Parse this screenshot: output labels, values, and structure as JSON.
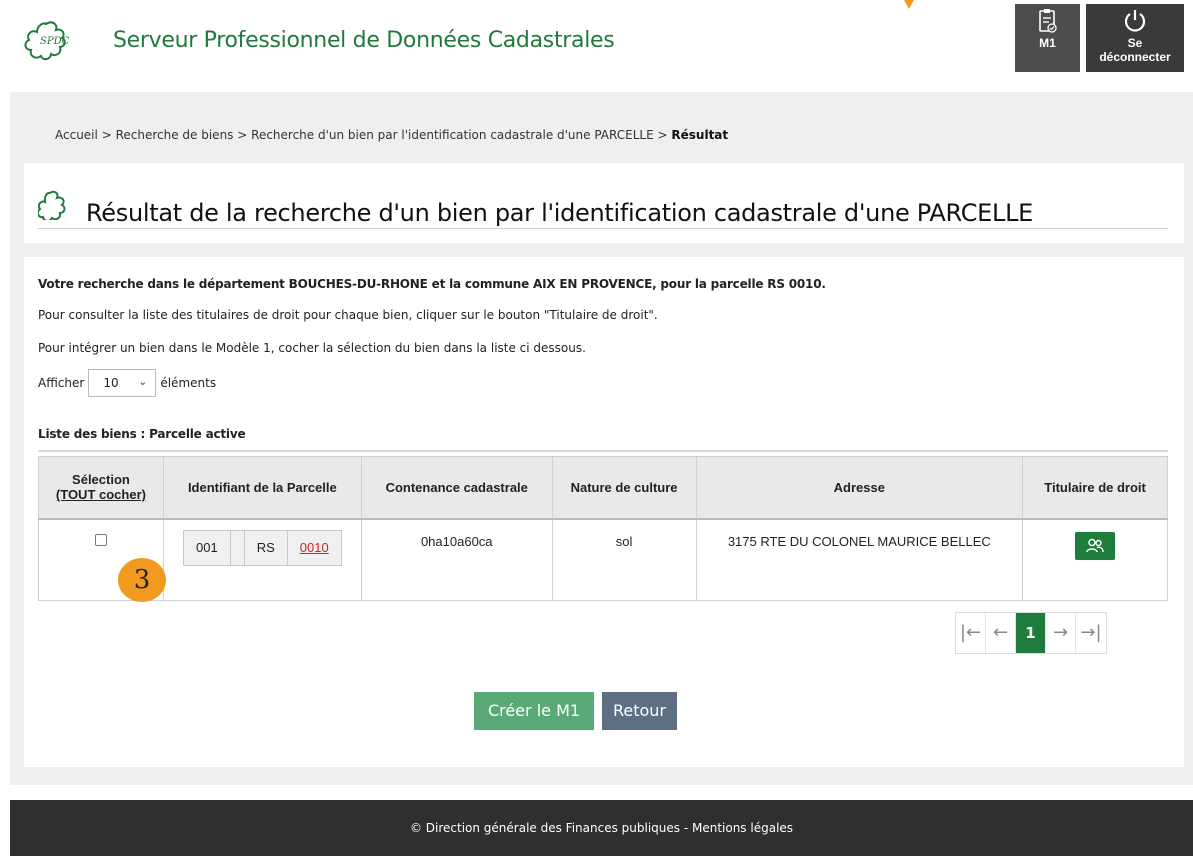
{
  "header": {
    "app_title": "Serveur Professionnel de Données Cadastrales",
    "logo_text": "SPDC",
    "m1_label": "M1",
    "logout_label_line1": "Se",
    "logout_label_line2": "déconnecter"
  },
  "breadcrumb": {
    "items": [
      "Accueil",
      "Recherche de biens",
      "Recherche d'un bien par l'identification cadastrale d'une PARCELLE"
    ],
    "separator": ">",
    "current": "Résultat"
  },
  "page_title": "Résultat de la recherche d'un bien par l'identification cadastrale d'une PARCELLE",
  "content": {
    "summary": "Votre recherche dans le département BOUCHES-DU-RHONE et la commune AIX EN PROVENCE, pour la parcelle RS 0010.",
    "hint1": "Pour consulter la liste des titulaires de droit pour chaque bien, cliquer sur le bouton \"Titulaire de droit\".",
    "hint2": "Pour intégrer un bien dans le Modèle 1, cocher la sélection du bien dans la liste ci dessous.",
    "show_label": "Afficher",
    "show_value": "10",
    "show_suffix": "éléments",
    "list_title": "Liste des biens : Parcelle active"
  },
  "table": {
    "headers": {
      "selection": "Sélection",
      "select_all": "(TOUT cocher)",
      "parcel_id": "Identifiant de la Parcelle",
      "area": "Contenance cadastrale",
      "culture": "Nature de culture",
      "address": "Adresse",
      "holder": "Titulaire de droit"
    },
    "rows": [
      {
        "prefix": "001",
        "section": "RS",
        "plan": "0010",
        "area": "0ha10a60ca",
        "culture": "sol",
        "address": "3175 RTE DU COLONEL MAURICE BELLEC"
      }
    ]
  },
  "annotation_badge": "3",
  "pagination": {
    "first": "|←",
    "prev": "←",
    "current": "1",
    "next": "→",
    "last": "→|"
  },
  "actions": {
    "create_label": "Créer le M1",
    "back_label": "Retour"
  },
  "footer": {
    "text": "© Direction générale des Finances publiques - Mentions légales"
  },
  "colors": {
    "brand_green": "#1e7d3c",
    "accent_orange": "#f29a1f",
    "create_button": "#5aaa77",
    "back_button": "#5e6f83",
    "link_red": "#d92020"
  }
}
